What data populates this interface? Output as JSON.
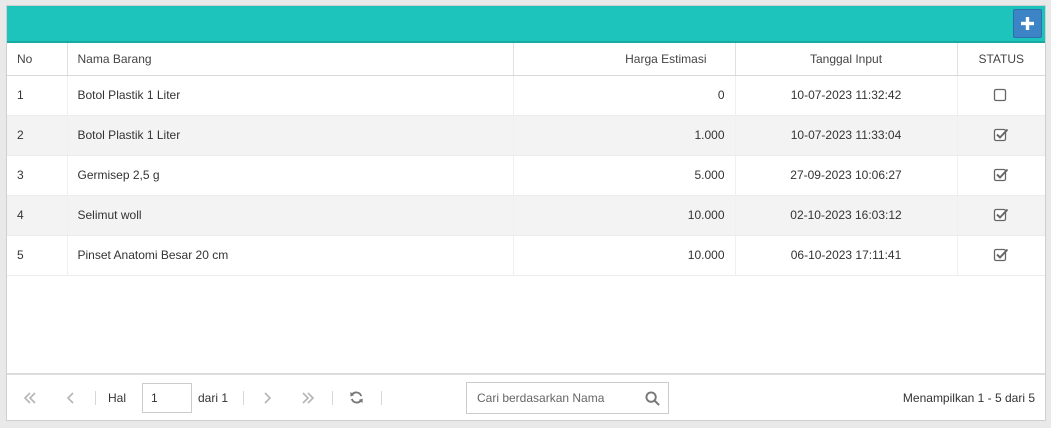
{
  "table": {
    "headers": {
      "no": "No",
      "name": "Nama Barang",
      "price": "Harga Estimasi",
      "date": "Tanggal Input",
      "status": "STATUS"
    },
    "rows": [
      {
        "no": "1",
        "name": "Botol Plastik 1 Liter",
        "price": "0",
        "date": "10-07-2023 11:32:42",
        "checked": false
      },
      {
        "no": "2",
        "name": "Botol Plastik 1 Liter",
        "price": "1.000",
        "date": "10-07-2023 11:33:04",
        "checked": true
      },
      {
        "no": "3",
        "name": "Germisep 2,5 g",
        "price": "5.000",
        "date": "27-09-2023 10:06:27",
        "checked": true
      },
      {
        "no": "4",
        "name": "Selimut woll",
        "price": "10.000",
        "date": "02-10-2023 16:03:12",
        "checked": true
      },
      {
        "no": "5",
        "name": "Pinset Anatomi Besar 20 cm",
        "price": "10.000",
        "date": "06-10-2023 17:11:41",
        "checked": true
      }
    ]
  },
  "pager": {
    "page_label": "Hal",
    "page_value": "1",
    "of_label": "dari 1",
    "search_placeholder": "Cari berdasarkan Nama",
    "summary": "Menampilkan 1 - 5 dari 5"
  },
  "colors": {
    "header_bar": "#1dc4bc",
    "add_button": "#3d84c6"
  },
  "icons": {
    "add": "plus-icon",
    "first": "double-chevron-left-icon",
    "prev": "chevron-left-icon",
    "next": "chevron-right-icon",
    "last": "double-chevron-right-icon",
    "refresh": "refresh-icon",
    "search": "search-icon"
  }
}
